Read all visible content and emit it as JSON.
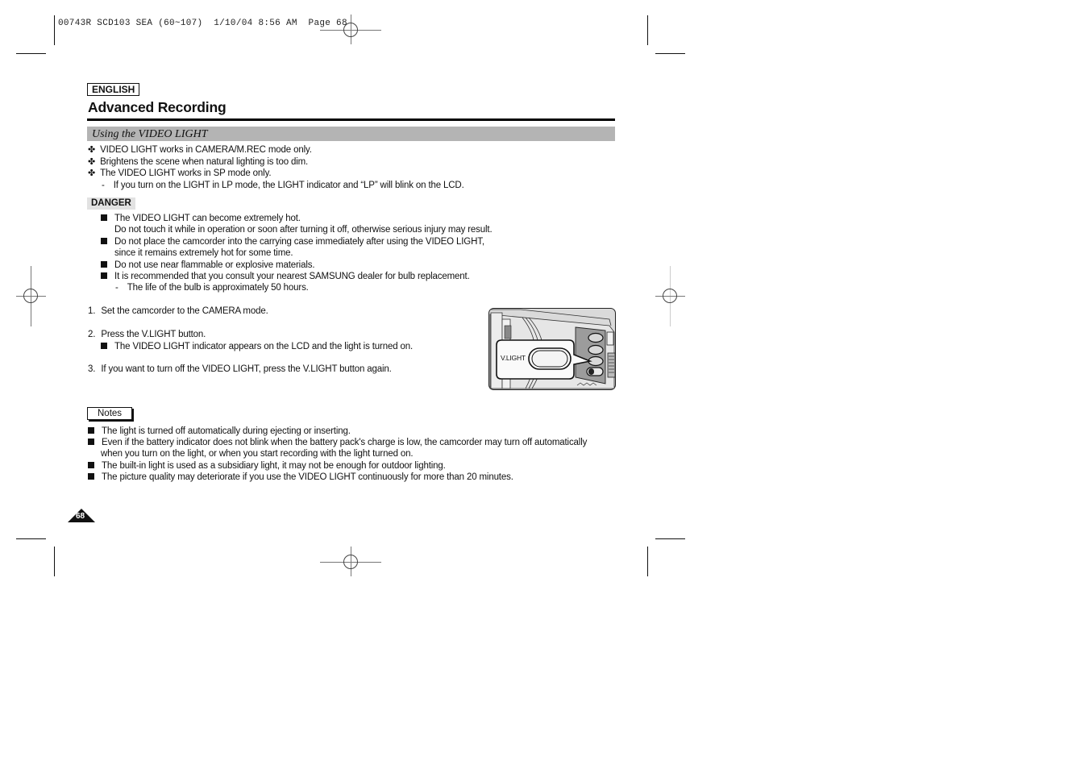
{
  "slug": {
    "text": "00743R SCD103 SEA (60~107)  1/10/04 8:56 AM  Page 68"
  },
  "header": {
    "language": "ENGLISH",
    "title": "Advanced Recording"
  },
  "section": {
    "title": "Using the VIDEO LIGHT"
  },
  "intro": {
    "bullet_icon": "four-leaf-cross-icon",
    "items": [
      "VIDEO LIGHT works in CAMERA/M.REC mode only.",
      "Brightens the scene when natural lighting is too dim.",
      "The VIDEO LIGHT works in SP mode only."
    ],
    "sub_item": "If you turn on the LIGHT in LP mode, the LIGHT indicator and “LP” will blink on the LCD."
  },
  "danger": {
    "label": "DANGER",
    "items": [
      {
        "lines": [
          "The VIDEO LIGHT can become extremely hot.",
          "Do not touch it while in operation or soon after turning it off, otherwise serious injury may result."
        ]
      },
      {
        "lines": [
          "Do not place the camcorder into the carrying case immediately after using the VIDEO LIGHT,",
          "since it remains extremely hot for some time."
        ]
      },
      {
        "lines": [
          "Do not use near flammable or explosive materials."
        ]
      },
      {
        "lines": [
          "It is recommended that you consult your nearest SAMSUNG dealer for bulb replacement."
        ]
      }
    ],
    "sub_item": "The life of the bulb is approximately 50 hours."
  },
  "steps": [
    {
      "number": "1.",
      "text": "Set the camcorder to the CAMERA mode."
    },
    {
      "number": "2.",
      "text": "Press the V.LIGHT button.",
      "sub": "The VIDEO LIGHT indicator appears on the LCD and the light is turned on."
    },
    {
      "number": "3.",
      "text": "If you want to turn off the VIDEO LIGHT, press the V.LIGHT button again."
    }
  ],
  "illustration": {
    "callout_label": "V.LIGHT"
  },
  "notes": {
    "label": "Notes",
    "items": [
      {
        "lines": [
          "The light is turned off automatically during ejecting or inserting."
        ]
      },
      {
        "lines": [
          "Even if the battery indicator does not blink when the battery pack's charge is low, the camcorder may turn off automatically",
          "when you turn on the light, or when you start recording with the light turned on."
        ]
      },
      {
        "lines": [
          "The built-in light is used as a subsidiary light, it may not be enough for outdoor lighting."
        ]
      },
      {
        "lines": [
          "The picture quality may deteriorate if you use the VIDEO LIGHT continuously for more than 20 minutes."
        ]
      }
    ]
  },
  "footer": {
    "page_number": "68"
  }
}
